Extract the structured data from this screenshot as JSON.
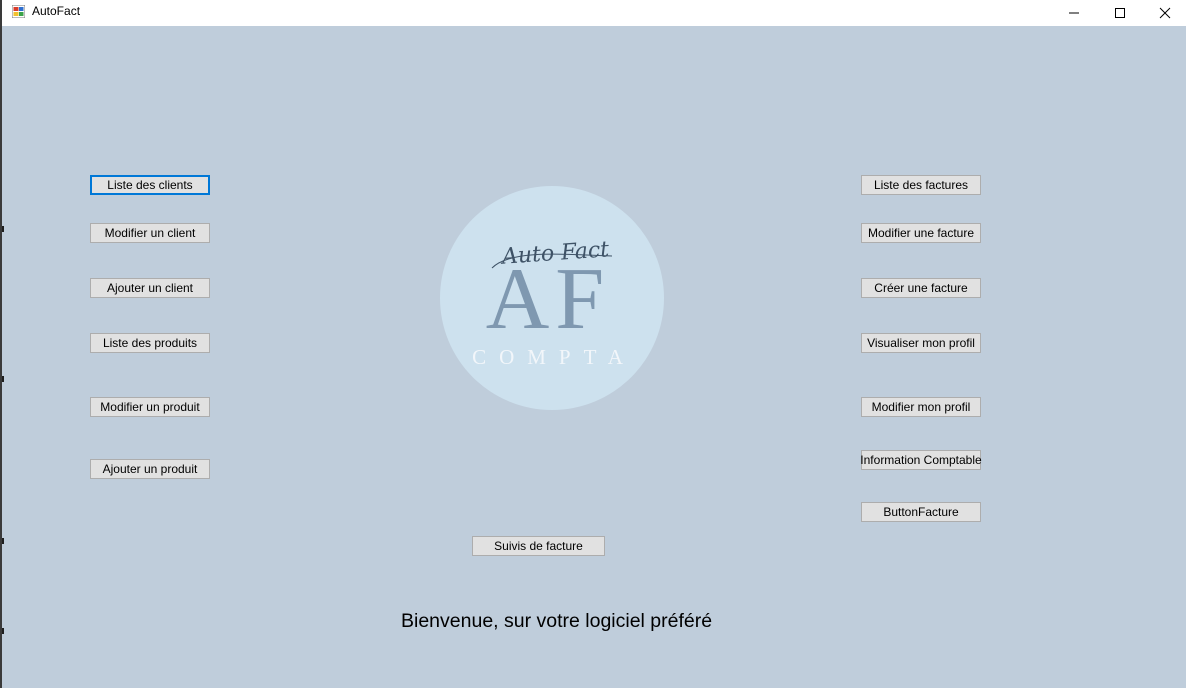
{
  "window": {
    "title": "AutoFact",
    "controls": {
      "minimize": "—",
      "maximize": "☐",
      "close": "✕"
    }
  },
  "left_buttons": [
    "Liste des clients",
    "Modifier un client",
    "Ajouter un client",
    "Liste des produits",
    "Modifier un produit",
    "Ajouter un produit"
  ],
  "right_buttons": [
    "Liste des factures",
    "Modifier une facture",
    "Créer une facture",
    "Visualiser mon profil",
    "Modifier mon profil",
    "Information Comptable",
    "ButtonFacture"
  ],
  "center_button": "Suivis de facture",
  "logo": {
    "letters": "AF",
    "script_text": "Auto Fact",
    "subtitle": "COMPTA"
  },
  "welcome_text": "Bienvenue, sur votre logiciel préféré",
  "colors": {
    "background": "#bfcddb",
    "logo_circle": "#cde1ee",
    "logo_letters": "#7f98b0",
    "logo_subtitle": "#f2f6fa",
    "focus_border": "#0078d7"
  }
}
